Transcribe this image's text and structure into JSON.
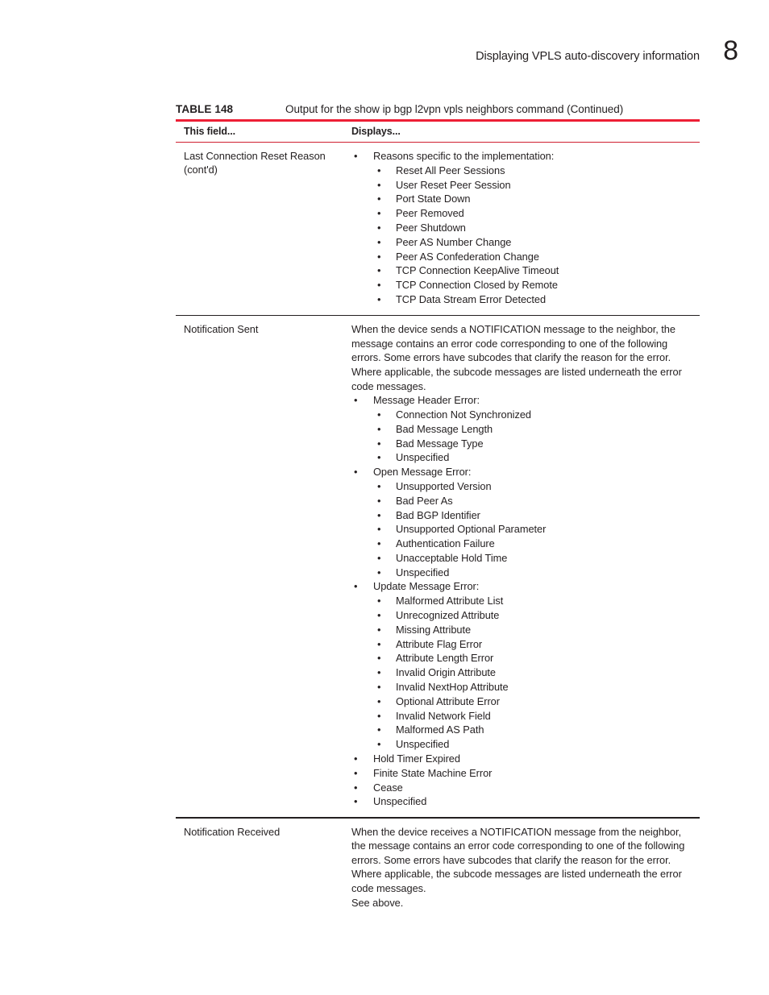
{
  "page": {
    "header_title": "Displaying VPLS auto-discovery information",
    "folio": "8"
  },
  "colors": {
    "rule_red_thick": "#ed1f35",
    "rule_red_thin": "#cf2030",
    "rule_dark": "#231f20",
    "text": "#231f20"
  },
  "table": {
    "label": "TABLE 148",
    "caption": "Output for the show ip bgp l2vpn vpls neighbors command  (Continued)",
    "columns": [
      "This field...",
      "Displays..."
    ],
    "rows": [
      {
        "field": "Last Connection Reset Reason (cont'd)",
        "field_line1": "Last Connection Reset Reason",
        "field_line2": "(cont'd)",
        "bullets": [
          {
            "text": "Reasons specific to the implementation:",
            "children": [
              "Reset All Peer Sessions",
              "User Reset Peer Session",
              "Port State Down",
              "Peer Removed",
              "Peer Shutdown",
              "Peer AS Number Change",
              "Peer AS Confederation Change",
              "TCP Connection KeepAlive Timeout",
              "TCP Connection Closed by Remote",
              "TCP Data Stream Error Detected"
            ]
          }
        ]
      },
      {
        "field": "Notification Sent",
        "paragraph": "When the device sends a NOTIFICATION message to the neighbor, the message contains an error code corresponding to one of the following errors. Some errors have subcodes that clarify the reason for the error. Where applicable, the subcode messages are listed underneath the error code messages.",
        "bullets": [
          {
            "text": "Message Header Error:",
            "children": [
              "Connection Not Synchronized",
              "Bad Message Length",
              "Bad Message Type",
              "Unspecified"
            ]
          },
          {
            "text": "Open Message Error:",
            "children": [
              "Unsupported Version",
              "Bad Peer As",
              "Bad BGP Identifier",
              "Unsupported Optional Parameter",
              "Authentication Failure",
              "Unacceptable Hold Time",
              "Unspecified"
            ]
          },
          {
            "text": "Update Message Error:",
            "children": [
              "Malformed Attribute List",
              "Unrecognized Attribute",
              "Missing Attribute",
              "Attribute Flag Error",
              "Attribute Length Error",
              "Invalid Origin Attribute",
              "Invalid NextHop Attribute",
              "Optional Attribute Error",
              "Invalid Network Field",
              "Malformed AS Path",
              "Unspecified"
            ]
          },
          {
            "text": "Hold Timer Expired",
            "children": []
          },
          {
            "text": "Finite State Machine Error",
            "children": []
          },
          {
            "text": "Cease",
            "children": []
          },
          {
            "text": "Unspecified",
            "children": []
          }
        ]
      },
      {
        "field": "Notification Received",
        "paragraph": "When the device receives a NOTIFICATION message from the neighbor, the message contains an error code corresponding to one of the following errors. Some errors have subcodes that clarify the reason for the error. Where applicable, the subcode messages are listed underneath the error code messages.",
        "paragraph2": "See above.",
        "bullets": []
      }
    ]
  },
  "glyphs": {
    "bullet": "•"
  }
}
